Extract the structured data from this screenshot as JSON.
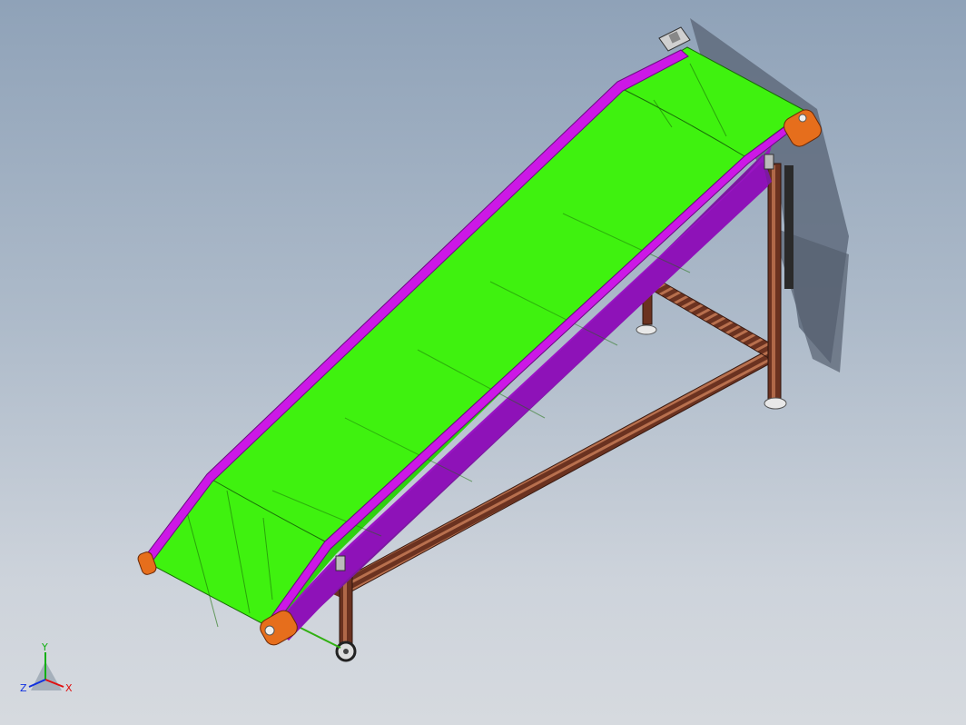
{
  "viewport": {
    "background_top": "#8fa2b8",
    "background_bottom": "#d6dadf"
  },
  "model": {
    "part_colors": {
      "belt": "#3ff20f",
      "belt_shade": "#2fd010",
      "side_guard": "#cc18e6",
      "side_guard_dark": "#8e12b8",
      "end_plate": "#e66e1c",
      "frame": "#5a2a1a",
      "frame_light": "#b5694a",
      "shadow": "#5f6b7c"
    }
  },
  "triad": {
    "x_label": "X",
    "y_label": "Y",
    "z_label": "Z",
    "x_color": "#e01010",
    "y_color": "#10b010",
    "z_color": "#1030e0"
  }
}
